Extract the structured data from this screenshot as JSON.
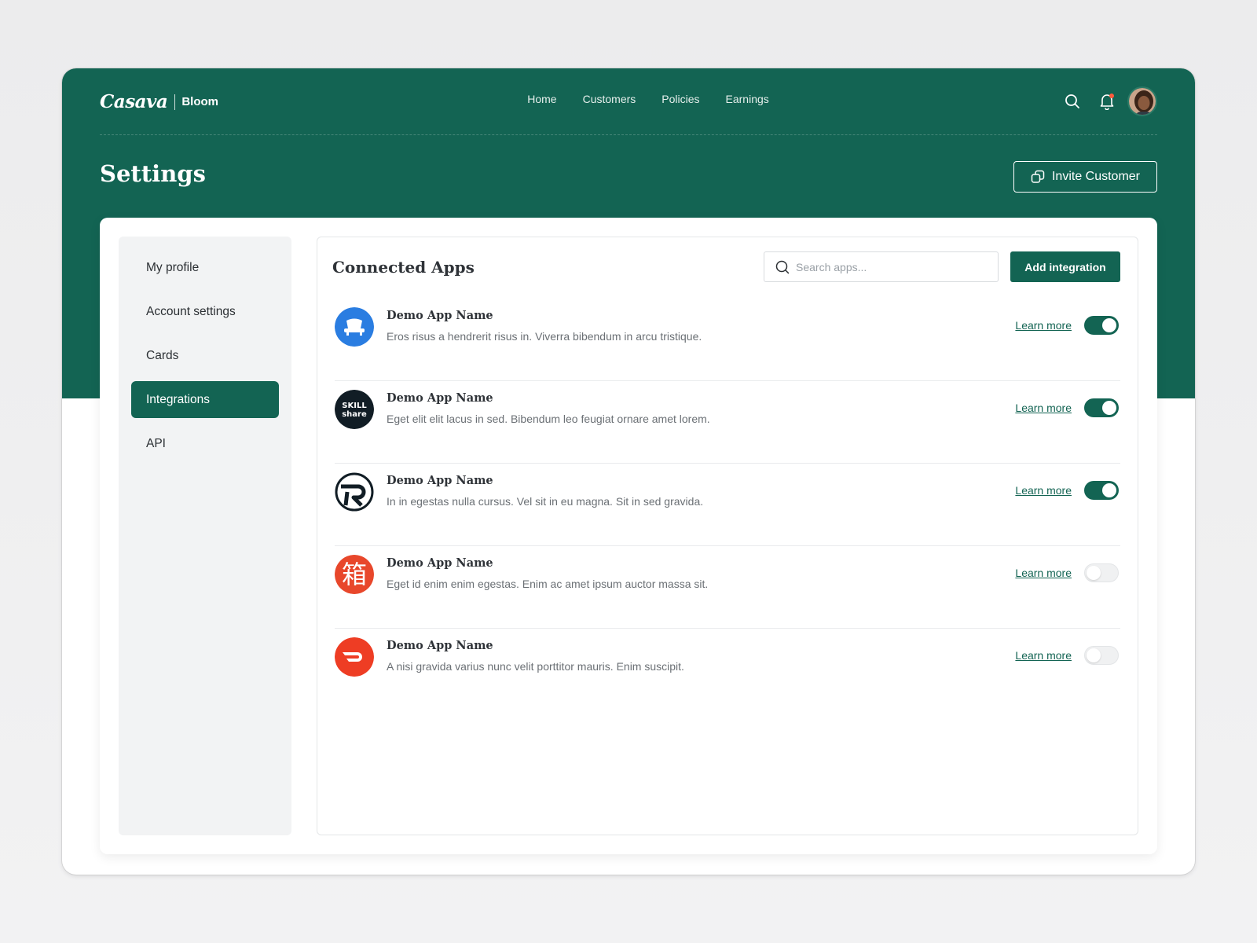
{
  "brand": {
    "name": "Casava",
    "product": "Bloom"
  },
  "nav": [
    {
      "label": "Home"
    },
    {
      "label": "Customers"
    },
    {
      "label": "Policies"
    },
    {
      "label": "Earnings"
    }
  ],
  "header": {
    "icons": [
      "search-icon",
      "bell-icon"
    ],
    "bell_has_notification": true,
    "page_title": "Settings",
    "invite_label": "Invite Customer"
  },
  "sidebar": {
    "items": [
      {
        "label": "My profile",
        "active": false
      },
      {
        "label": "Account settings",
        "active": false
      },
      {
        "label": "Cards",
        "active": false
      },
      {
        "label": "Integrations",
        "active": true
      },
      {
        "label": "API",
        "active": false
      }
    ]
  },
  "panel": {
    "title": "Connected Apps",
    "search_placeholder": "Search apps...",
    "add_label": "Add integration",
    "learn_more_label": "Learn more",
    "apps": [
      {
        "name": "Demo App Name",
        "description": "Eros risus a hendrerit risus in. Viverra bibendum in arcu tristique.",
        "enabled": true,
        "logo": "blue-sofa-logo"
      },
      {
        "name": "Demo App Name",
        "description": "Eget elit elit lacus in sed. Bibendum leo feugiat ornare amet lorem.",
        "enabled": true,
        "logo": "skillshare-logo"
      },
      {
        "name": "Demo App Name",
        "description": "In in egestas nulla cursus. Vel sit in eu magna. Sit in sed gravida.",
        "enabled": true,
        "logo": "r-circle-logo"
      },
      {
        "name": "Demo App Name",
        "description": "Eget id enim enim egestas. Enim ac amet ipsum auctor massa sit.",
        "enabled": false,
        "logo": "red-kanji-logo"
      },
      {
        "name": "Demo App Name",
        "description": "A nisi gravida varius nunc velit porttitor mauris. Enim suscipit.",
        "enabled": false,
        "logo": "doordash-logo"
      }
    ]
  },
  "colors": {
    "brand_green": "#136453",
    "page_bg": "#ececed",
    "toggle_off": "#f0f1f2",
    "logo_text": "SKILL share",
    "logo_kanji": "箱"
  }
}
